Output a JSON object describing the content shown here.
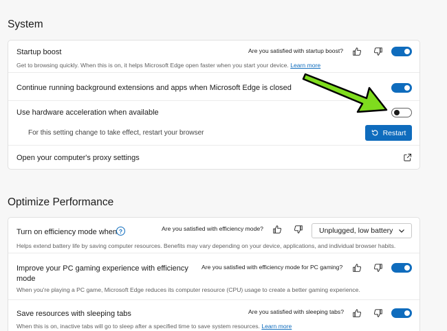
{
  "system": {
    "heading": "System",
    "startup_boost": {
      "title": "Startup boost",
      "feedback": "Are you satisfied with startup boost?",
      "description": "Get to browsing quickly. When this is on, it helps Microsoft Edge open faster when you start your device.",
      "link": "Learn more",
      "enabled": true
    },
    "background_apps": {
      "title": "Continue running background extensions and apps when Microsoft Edge is closed",
      "enabled": true
    },
    "hardware_accel": {
      "title": "Use hardware acceleration when available",
      "enabled": false,
      "restart_note": "For this setting change to take effect, restart your browser",
      "restart_label": "Restart"
    },
    "proxy": {
      "title": "Open your computer's proxy settings"
    }
  },
  "performance": {
    "heading": "Optimize Performance",
    "efficiency_mode": {
      "title": "Turn on efficiency mode when",
      "help_glyph": "?",
      "feedback": "Are you satisfied with efficiency mode?",
      "select_value": "Unplugged, low battery",
      "description": "Helps extend battery life by saving computer resources. Benefits may vary depending on your device, applications, and individual browser habits."
    },
    "gaming": {
      "title_line1": "Improve your PC gaming experience with efficiency",
      "title_line2": "mode",
      "feedback": "Are you satisfied with efficiency mode for PC gaming?",
      "description": "When you're playing a PC game, Microsoft Edge reduces its computer resource (CPU) usage to create a better gaming experience.",
      "enabled": true
    },
    "sleeping_tabs": {
      "title": "Save resources with sleeping tabs",
      "feedback": "Are you satisfied with sleeping tabs?",
      "description": "When this is on, inactive tabs will go to sleep after a specified time to save system resources.",
      "link": "Learn more",
      "enabled": true
    }
  },
  "colors": {
    "accent": "#0f6cbd",
    "annotation_arrow": "#7fdc1e"
  }
}
